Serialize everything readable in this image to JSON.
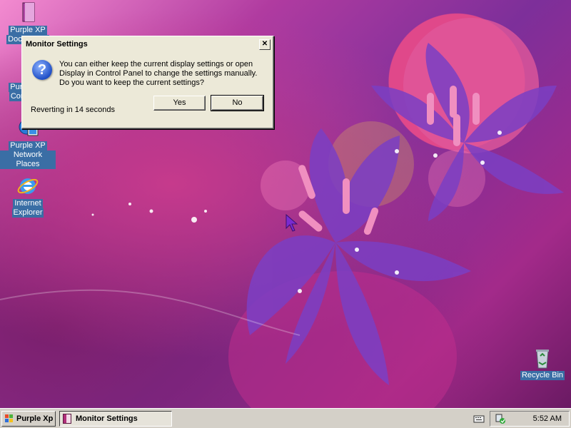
{
  "desktop": {
    "icons": [
      {
        "label_line1": "Purple XP",
        "label_line2": "Documents"
      },
      {
        "label_line1": "Purple XP",
        "label_line2": "Computer"
      },
      {
        "label_line1": "Purple XP",
        "label_line2": "Network Places"
      },
      {
        "label_line1": "Internet",
        "label_line2": "Explorer"
      },
      {
        "label_line1": "Recycle Bin"
      }
    ]
  },
  "dialog": {
    "title": "Monitor Settings",
    "close_glyph": "✕",
    "icon_glyph": "?",
    "message_line1": "You can either keep the current display settings or open",
    "message_line2": "Display in Control Panel to change the settings manually.",
    "message_line3": "Do you want to keep the current settings?",
    "countdown": "Reverting in 14 seconds",
    "yes_label": "Yes",
    "no_label": "No"
  },
  "taskbar": {
    "start_label": "Purple Xp",
    "task_label": "Monitor Settings",
    "clock": "5:52 AM"
  },
  "colors": {
    "accent": "#3a6ea5",
    "dialog_bg": "#ece9d8",
    "taskbar_bg": "#d4d0c8"
  }
}
